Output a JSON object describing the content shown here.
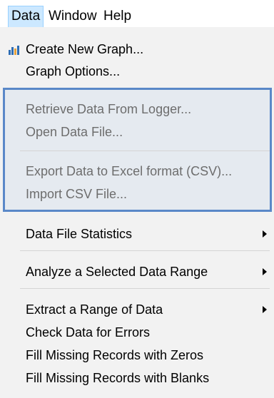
{
  "menubar": {
    "items": [
      "Data",
      "Window",
      "Help"
    ]
  },
  "menu": {
    "create_graph": "Create New Graph...",
    "graph_options": "Graph Options...",
    "retrieve_data": "Retrieve Data From Logger...",
    "open_data_file": "Open Data File...",
    "export_csv": "Export Data to Excel format (CSV)...",
    "import_csv": "Import CSV File...",
    "file_statistics": "Data File Statistics",
    "analyze_range": "Analyze a Selected Data Range",
    "extract_range": "Extract a Range of Data",
    "check_errors": "Check Data for Errors",
    "fill_zeros": "Fill Missing Records with Zeros",
    "fill_blanks": "Fill Missing Records with Blanks"
  },
  "colors": {
    "menu_background": "#f2f2f2",
    "active_menu": "#cce8ff",
    "highlight_border": "#5a88c8",
    "disabled_text": "#6d6d6d",
    "icon_blue": "#2e6db4",
    "icon_orange": "#e8a33c"
  },
  "icons": {
    "create_graph": "bar-chart-icon",
    "submenu": "submenu-arrow-icon"
  }
}
